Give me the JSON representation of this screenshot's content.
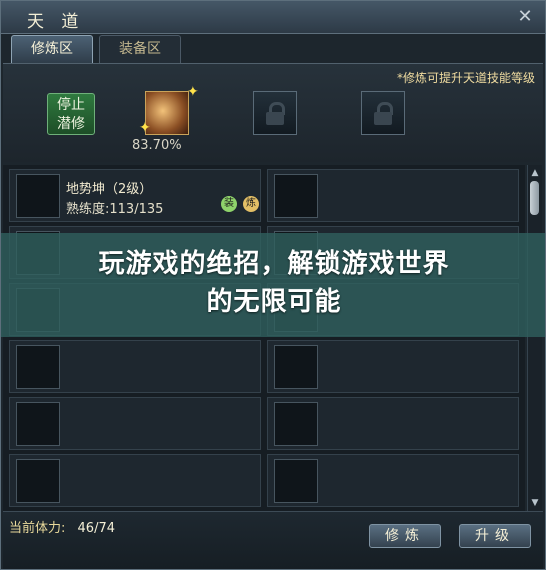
{
  "window": {
    "title": "天 道",
    "close": "✕"
  },
  "tabs": [
    {
      "label": "修炼区"
    },
    {
      "label": "装备区"
    }
  ],
  "panel": {
    "hint": "*修炼可提升天道技能等级",
    "stop_line1": "停止",
    "stop_line2": "潜修",
    "progress": "83.70%"
  },
  "skill": {
    "name": "地势坤（2级）",
    "proficiency": "熟练度:113/135",
    "badge1": "装",
    "badge2": "炼"
  },
  "banner": {
    "line1": "玩游戏的绝招，解锁游戏世界",
    "line2": "的无限可能"
  },
  "footer": {
    "stamina_label": "当前体力:",
    "stamina_value": "46/74",
    "cultivate_button": "修炼",
    "upgrade_button": "升级"
  }
}
